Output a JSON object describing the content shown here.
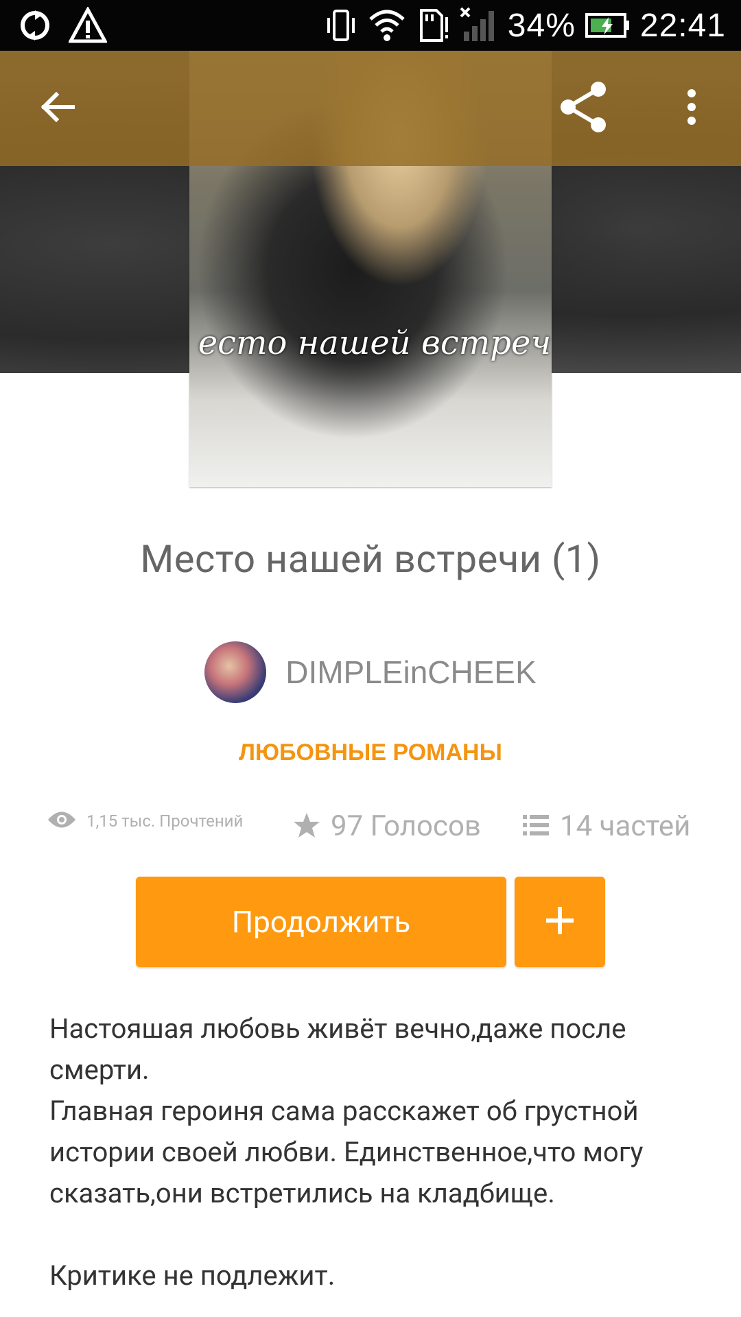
{
  "status_bar": {
    "battery_percent": "34%",
    "time": "22:41",
    "icons": [
      "sync-icon",
      "warning-icon",
      "vibrate-icon",
      "wifi-icon",
      "sd-card-icon",
      "signal-icon",
      "battery-charging-icon"
    ]
  },
  "toolbar": {
    "back_icon": "arrow-back-icon",
    "share_icon": "share-icon",
    "more_icon": "more-vert-icon"
  },
  "cover": {
    "caption": "есто нашей встреч"
  },
  "story": {
    "title": "Место нашей встречи (1)",
    "author": "DIMPLEinCHEEK",
    "genre": "ЛЮБОВНЫЕ РОМАНЫ"
  },
  "stats": {
    "reads": "1,15 тыс. Прочтений",
    "votes": "97 Голосов",
    "parts": "14 частей"
  },
  "actions": {
    "continue_label": "Продолжить",
    "add_label": "+"
  },
  "description": {
    "line1": "Настояшая любовь живёт вечно,даже после смерти.",
    "line2": "Главная героиня сама расскажет об грустной истории своей любви. Единственное,что могу сказать,они встретились на кладбище.",
    "line3": "Критике не подлежит."
  },
  "colors": {
    "accent": "#fe9910",
    "genre": "#f5940f",
    "toolbar": "#96702a"
  }
}
